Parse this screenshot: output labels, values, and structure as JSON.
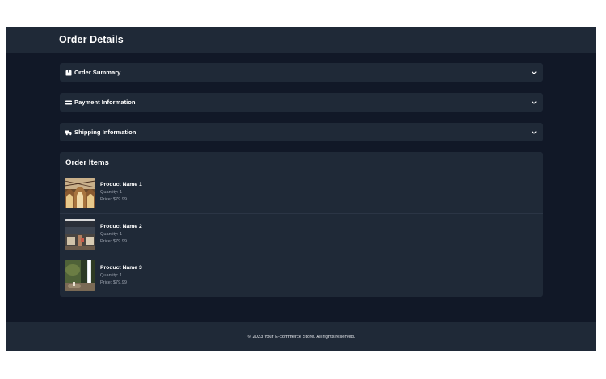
{
  "header": {
    "title": "Order Details"
  },
  "sections": [
    {
      "label": "Order Summary",
      "icon": "box-icon"
    },
    {
      "label": "Payment Information",
      "icon": "credit-card-icon"
    },
    {
      "label": "Shipping Information",
      "icon": "truck-icon"
    }
  ],
  "order_items": {
    "title": "Order Items",
    "items": [
      {
        "name": "Product Name 1",
        "quantity": "Quantity: 1",
        "price": "Price: $79.99",
        "image": "product-image-arches"
      },
      {
        "name": "Product Name 2",
        "quantity": "Quantity: 1",
        "price": "Price: $79.99",
        "image": "product-image-interior"
      },
      {
        "name": "Product Name 3",
        "quantity": "Quantity: 1",
        "price": "Price: $79.99",
        "image": "product-image-waterfall"
      }
    ]
  },
  "footer": {
    "text": "© 2023 Your E-commerce Store. All rights reserved."
  },
  "colors": {
    "page_bg": "#111827",
    "panel_bg": "#1f2937",
    "text_primary": "#ffffff",
    "text_muted": "#9ca3af"
  }
}
